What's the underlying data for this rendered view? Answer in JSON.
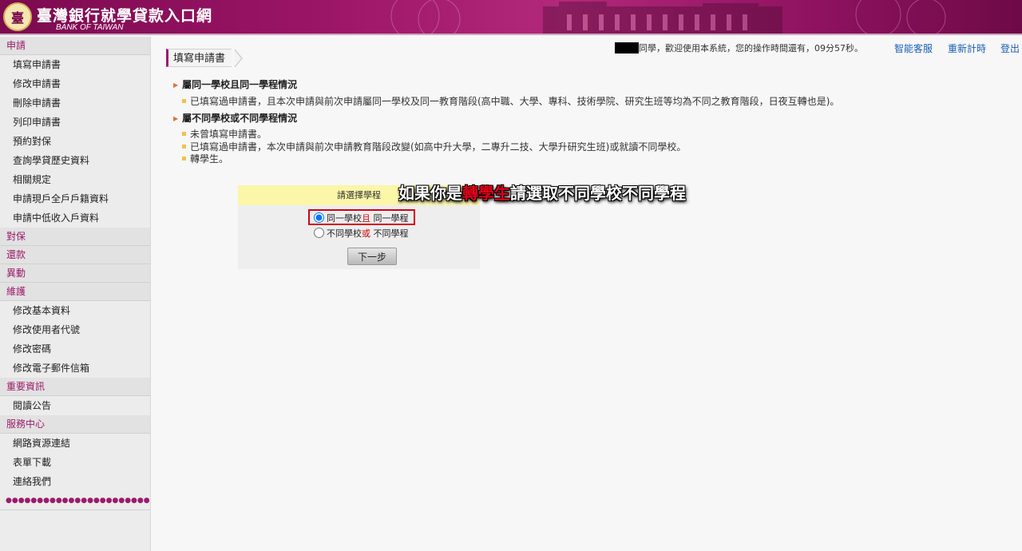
{
  "header": {
    "seal_char": "臺",
    "title": "臺灣銀行就學貸款入口網",
    "subtitle": "BANK OF TAIWAN",
    "color_brand": "#9b1b6b"
  },
  "sidebar": {
    "groups": [
      {
        "label": "申請",
        "items": [
          "填寫申請書",
          "修改申請書",
          "刪除申請書",
          "列印申請書",
          "預約對保",
          "查詢學貸歷史資料",
          "相關規定",
          "申請現戶全戶戶籍資料",
          "申請中低收入戶資料"
        ]
      },
      {
        "label": "對保",
        "items": []
      },
      {
        "label": "還款",
        "items": []
      },
      {
        "label": "異動",
        "items": []
      },
      {
        "label": "維護",
        "items": [
          "修改基本資料",
          "修改使用者代號",
          "修改密碼",
          "修改電子郵件信箱"
        ]
      },
      {
        "label": "重要資訊",
        "items": [
          "閱讀公告"
        ]
      },
      {
        "label": "服務中心",
        "items": [
          "網路資源連結",
          "表單下載",
          "連絡我們"
        ]
      }
    ],
    "dots": "●●●●●●●●●●●●●●●●●●●●●●●"
  },
  "userbar": {
    "welcome": "同學，歡迎使用本系統，您的操作時間還有，09分57秒。",
    "links": [
      "智能客服",
      "重新計時",
      "登出"
    ]
  },
  "main": {
    "page_title": "填寫申請書",
    "section1": {
      "heading": "屬同一學校且同一學程情況",
      "lines": [
        "已填寫過申請書，且本次申請與前次申請屬同一學校及同一教育階段(高中職、大學、專科、技術學院、研究生班等均為不同之教育階段，日夜互轉也是)。"
      ]
    },
    "section2": {
      "heading": "屬不同學校或不同學程情況",
      "lines": [
        "未曾填寫申請書。",
        "已填寫過申請書，本次申請與前次申請教育階段改變(如高中升大學，二專升二技、大學升研究生班)或就讀不同學校。",
        "轉學生。"
      ]
    },
    "panel": {
      "heading": "請選擇學程",
      "option1": {
        "a": "同一學校",
        "b": "且",
        "c": " 同一學程",
        "checked": true
      },
      "option2": {
        "a": "不同學校",
        "b": "或",
        "c": " 不同學程",
        "checked": false
      },
      "next_label": "下一步"
    },
    "annotation": {
      "pre": "如果你是",
      "highlight": "轉學生",
      "post": "請選取不同學校不同學程"
    }
  }
}
